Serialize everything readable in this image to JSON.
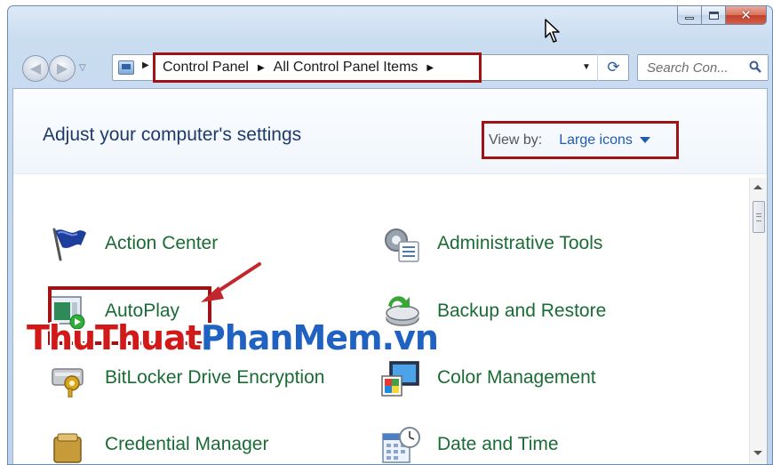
{
  "window": {
    "caption_buttons": {
      "minimize_icon": "minimize-icon",
      "maximize_icon": "maximize-icon",
      "close_glyph": "✕"
    }
  },
  "nav": {
    "back_icon": "back-arrow-icon",
    "forward_icon": "forward-arrow-icon",
    "address": {
      "breadcrumbs": [
        "Control Panel",
        "All Control Panel Items"
      ],
      "separator": "▶",
      "dropdown_glyph": "▼",
      "refresh_glyph": "⟳"
    },
    "search": {
      "placeholder": "Search Con..."
    }
  },
  "main": {
    "title": "Adjust your computer's settings",
    "view_by": {
      "label": "View by:",
      "value": "Large icons"
    },
    "items": [
      {
        "label": "Action Center",
        "icon": "flag-icon"
      },
      {
        "label": "Administrative Tools",
        "icon": "admin-tools-icon"
      },
      {
        "label": "AutoPlay",
        "icon": "autoplay-icon"
      },
      {
        "label": "Backup and Restore",
        "icon": "backup-icon"
      },
      {
        "label": "BitLocker Drive Encryption",
        "icon": "bitlocker-icon"
      },
      {
        "label": "Color Management",
        "icon": "color-management-icon"
      },
      {
        "label": "Credential Manager",
        "icon": "credential-icon"
      },
      {
        "label": "Date and Time",
        "icon": "calendar-clock-icon"
      }
    ]
  },
  "watermark": {
    "part1": "ThuThuat",
    "part2": "PhanMem.vn"
  },
  "colors": {
    "highlight_border": "#9f1316",
    "link_green": "#1a6b34",
    "title_blue": "#1e3b6a",
    "view_by_blue": "#1f5cae"
  }
}
